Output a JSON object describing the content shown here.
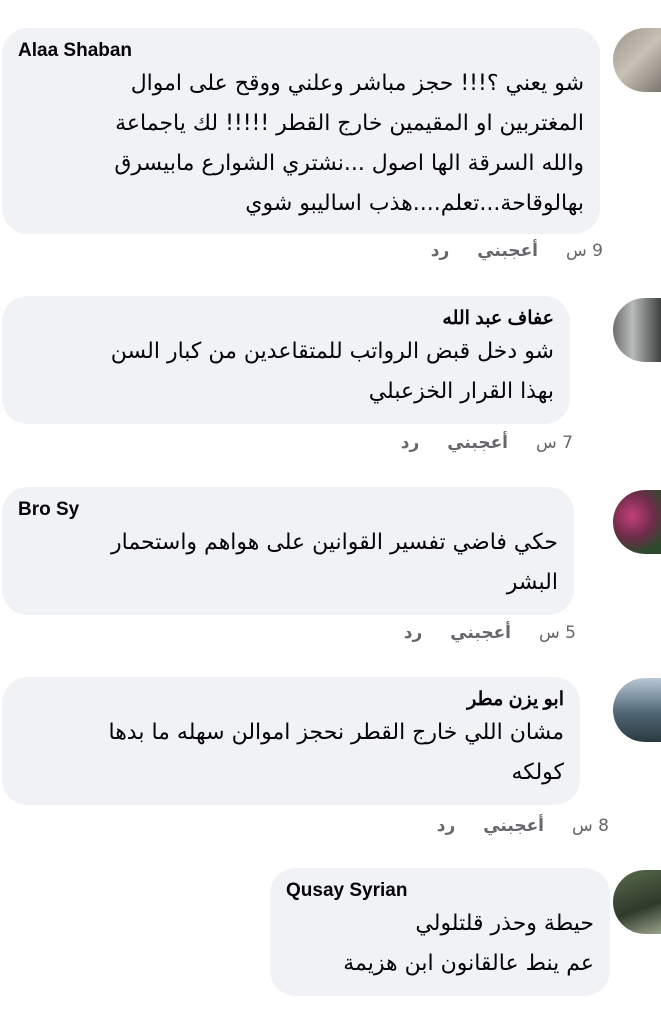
{
  "comments": [
    {
      "author": "Alaa Shaban",
      "lines": [
        "شو يعني ؟!!! حجز مباشر وعلني ووقح على اموال",
        "المغتربين او المقيمين خارج القطر !!!!! لك ياجماعة",
        "والله السرقة الها اصول ...نشتري الشوارع مابيسرق",
        "بهالوقاحة...تعلم....هذب اساليبو شوي"
      ],
      "time": "9 س",
      "like": "أعجبني",
      "reply": "رد"
    },
    {
      "author": "عفاف عبد الله",
      "lines": [
        "شو دخل قبض الرواتب للمتقاعدين من كبار السن",
        "بهذا القرار الخزعبلي"
      ],
      "time": "7 س",
      "like": "أعجبني",
      "reply": "رد"
    },
    {
      "author": "Bro Sy",
      "lines": [
        "حكي فاضي تفسير القوانين على هواهم واستحمار",
        "البشر"
      ],
      "time": "5 س",
      "like": "أعجبني",
      "reply": "رد"
    },
    {
      "author": "ابو يزن مطر",
      "lines": [
        "مشان اللي خارج القطر نحجز اموالن سهله ما بدها",
        "كولكه"
      ],
      "time": "8 س",
      "like": "أعجبني",
      "reply": "رد"
    },
    {
      "author": "Qusay Syrian",
      "lines": [
        "حيطة وحذر قلتلولي",
        "عم ينط عالقانون ابن هزيمة"
      ]
    }
  ]
}
